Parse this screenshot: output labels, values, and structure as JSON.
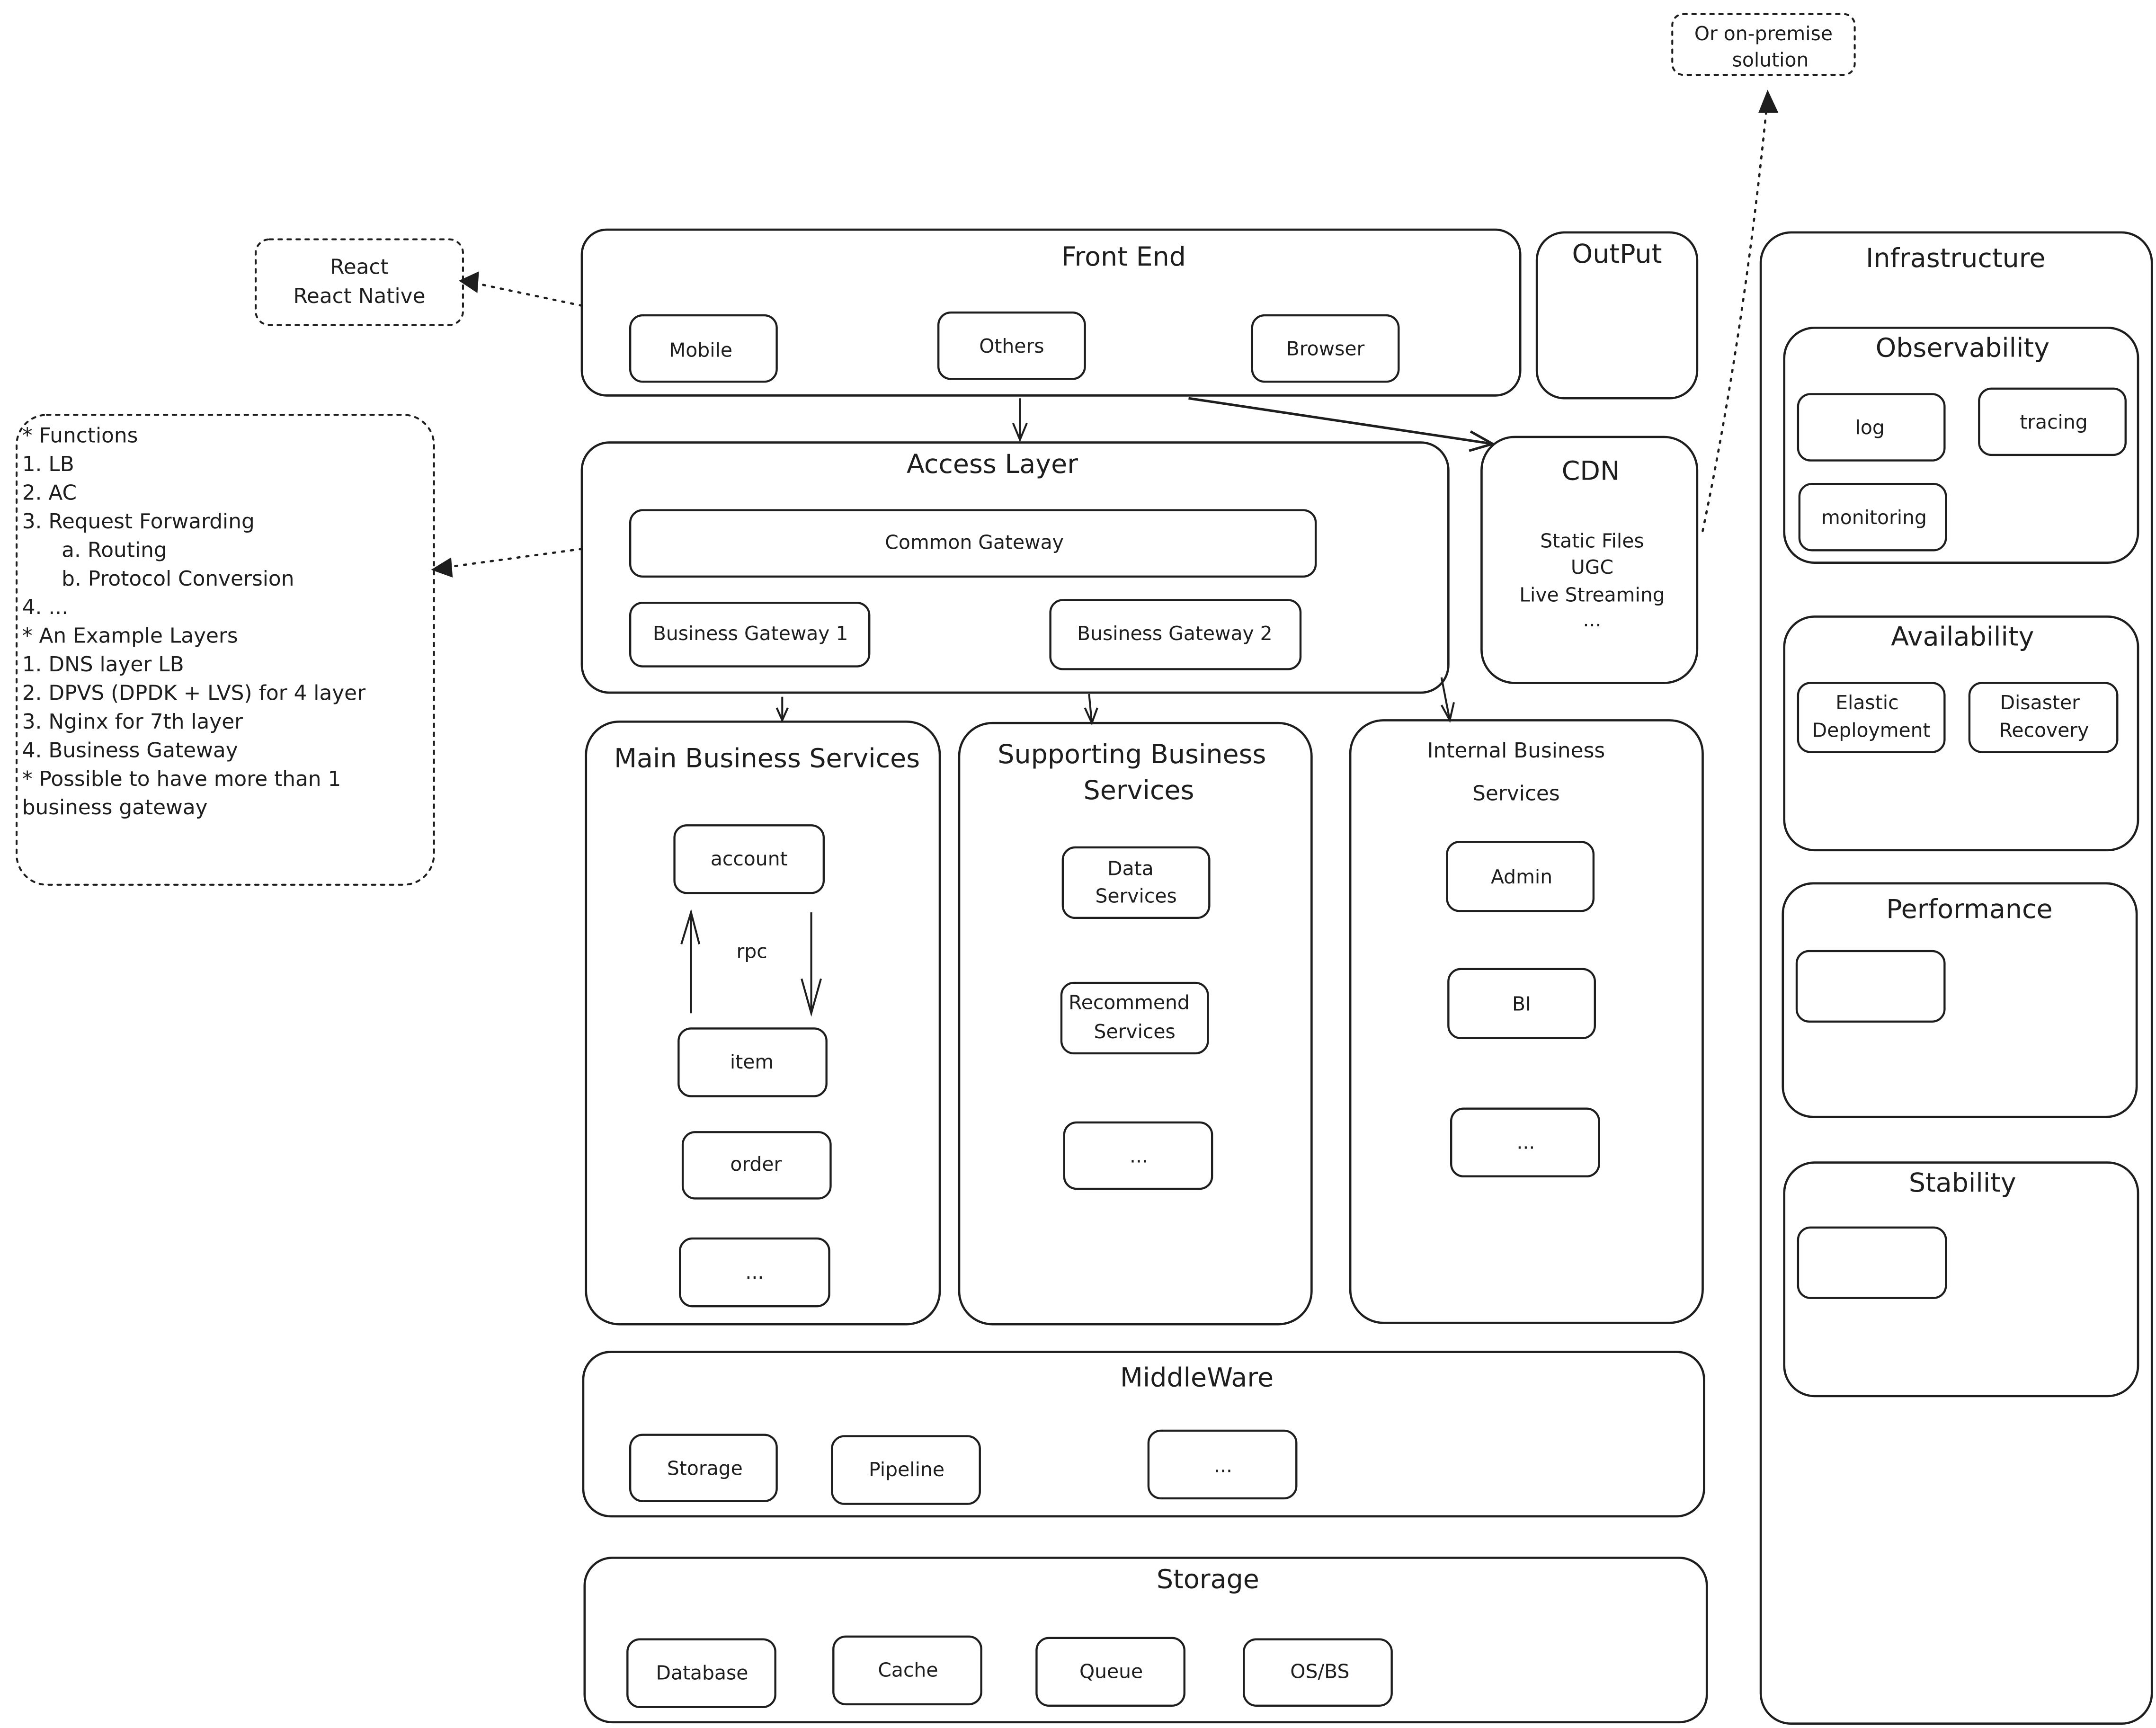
{
  "diagram": {
    "notes": {
      "react": [
        "React",
        "React Native"
      ],
      "on_premise": [
        "Or on-premise",
        "solution"
      ],
      "access_functions": [
        "* Functions",
        "1. LB",
        "2. AC",
        "3. Request Forwarding",
        "    a. Routing",
        "    b. Protocol Conversion",
        "4. ...",
        "",
        "* An Example Layers",
        "1. DNS layer LB",
        "2. DPVS (DPDK + LVS) for 4 layer",
        "3. Nginx for 7th layer",
        "4. Business Gateway",
        "",
        "* Possible to have more than 1",
        "business gateway"
      ]
    },
    "front_end": {
      "title": "Front End",
      "items": [
        "Mobile",
        "Others",
        "Browser"
      ]
    },
    "output": {
      "title": "OutPut"
    },
    "cdn": {
      "title": "CDN",
      "items": [
        "Static Files",
        "UGC",
        "Live Streaming",
        "..."
      ]
    },
    "access_layer": {
      "title": "Access Layer",
      "common_gateway": "Common Gateway",
      "business_gateways": [
        "Business Gateway 1",
        "Business Gateway 2"
      ]
    },
    "main_business": {
      "title": "Main Business Services",
      "items": [
        "account",
        "item",
        "order",
        "..."
      ],
      "rpc_label": "rpc"
    },
    "supporting_business": {
      "title_lines": [
        "Supporting Business",
        "Services"
      ],
      "items": [
        [
          "Data",
          "Services"
        ],
        [
          "Recommend",
          "Services"
        ],
        [
          "..."
        ]
      ]
    },
    "internal_business": {
      "title_lines": [
        "Internal Business",
        "Services"
      ],
      "items": [
        "Admin",
        "BI",
        "..."
      ]
    },
    "middleware": {
      "title": "MiddleWare",
      "items": [
        "Storage",
        "Pipeline",
        "..."
      ]
    },
    "storage": {
      "title": "Storage",
      "items": [
        "Database",
        "Cache",
        "Queue",
        "OS/BS"
      ]
    },
    "infrastructure": {
      "title": "Infrastructure",
      "groups": [
        {
          "title": "Observability",
          "items": [
            [
              "log"
            ],
            [
              "tracing"
            ],
            [
              "monitoring"
            ]
          ]
        },
        {
          "title": "Availability",
          "items": [
            [
              "Elastic",
              "Deployment"
            ],
            [
              "Disaster",
              "Recovery"
            ]
          ]
        },
        {
          "title": "Performance",
          "items": [
            [
              ""
            ]
          ]
        },
        {
          "title": "Stability",
          "items": [
            [
              ""
            ]
          ]
        }
      ]
    }
  }
}
